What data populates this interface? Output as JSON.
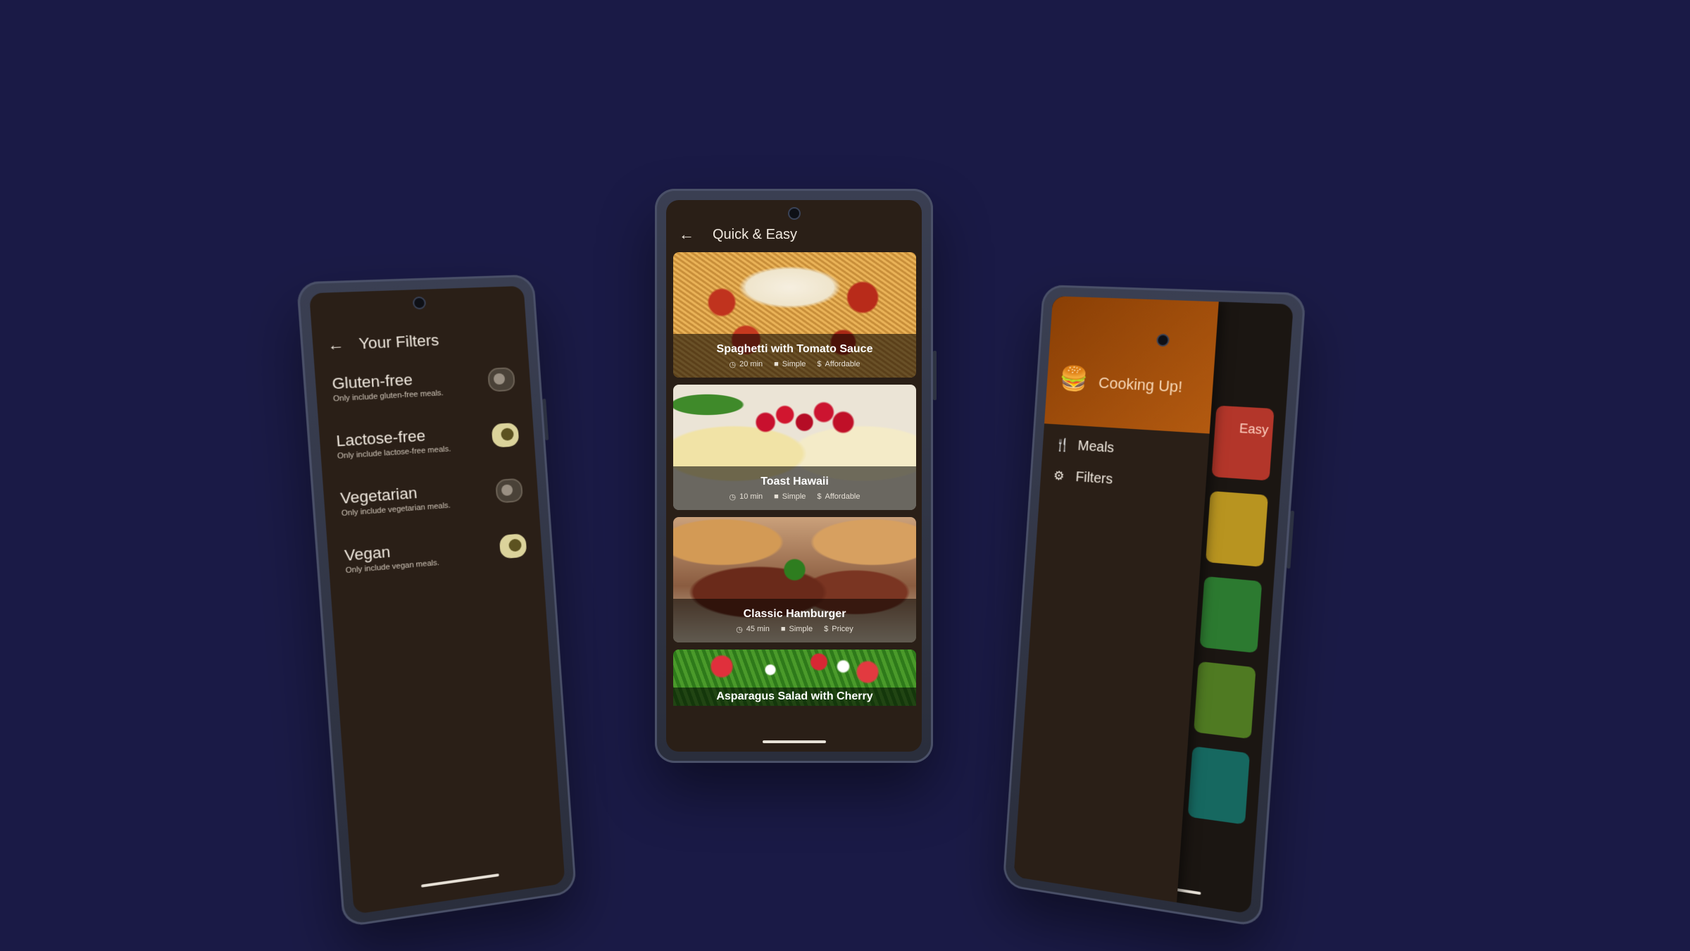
{
  "filters_screen": {
    "title": "Your Filters",
    "filters": [
      {
        "label": "Gluten-free",
        "desc": "Only include gluten-free meals.",
        "on": false
      },
      {
        "label": "Lactose-free",
        "desc": "Only include lactose-free meals.",
        "on": true
      },
      {
        "label": "Vegetarian",
        "desc": "Only include vegetarian meals.",
        "on": false
      },
      {
        "label": "Vegan",
        "desc": "Only include vegan meals.",
        "on": true
      }
    ]
  },
  "meals_screen": {
    "title": "Quick & Easy",
    "meals": [
      {
        "title": "Spaghetti with Tomato Sauce",
        "duration": "20 min",
        "complexity": "Simple",
        "affordability": "Affordable"
      },
      {
        "title": "Toast Hawaii",
        "duration": "10 min",
        "complexity": "Simple",
        "affordability": "Affordable"
      },
      {
        "title": "Classic Hamburger",
        "duration": "45 min",
        "complexity": "Simple",
        "affordability": "Pricey"
      },
      {
        "title": "Asparagus Salad with Cherry"
      }
    ]
  },
  "drawer_screen": {
    "app_name": "Cooking Up!",
    "items": [
      {
        "label": "Meals",
        "icon": "fork-knife-icon"
      },
      {
        "label": "Filters",
        "icon": "gear-icon"
      }
    ],
    "background_tile_label": "Easy",
    "tile_colors": [
      "#c0392b",
      "#c9a227",
      "#2e8b3a",
      "#5a8a2a",
      "#18706a"
    ]
  }
}
